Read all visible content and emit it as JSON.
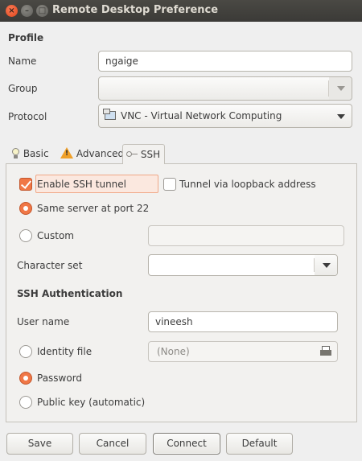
{
  "window": {
    "title": "Remote Desktop Preference",
    "close_glyph": "×",
    "min_glyph": "–",
    "max_glyph": "□"
  },
  "profile": {
    "section_title": "Profile",
    "name_label": "Name",
    "name_value": "ngaige",
    "group_label": "Group",
    "group_value": "",
    "protocol_label": "Protocol",
    "protocol_value": "VNC - Virtual Network Computing",
    "protocol_icon": "monitor-icon"
  },
  "tabs": [
    {
      "label": "Basic",
      "icon": "lightbulb-icon",
      "active": false
    },
    {
      "label": "Advanced",
      "icon": "warning-icon",
      "active": false
    },
    {
      "label": "SSH",
      "icon": "key-icon",
      "active": true
    }
  ],
  "ssh": {
    "enable_tunnel_label": "Enable SSH tunnel",
    "enable_tunnel_checked": true,
    "loopback_label": "Tunnel via loopback address",
    "loopback_checked": false,
    "same_server_label": "Same server at port 22",
    "same_server_selected": true,
    "custom_label": "Custom",
    "custom_selected": false,
    "custom_value": "",
    "charset_label": "Character set",
    "charset_value": "",
    "auth_title": "SSH Authentication",
    "username_label": "User name",
    "username_value": "vineesh",
    "identity_label": "Identity file",
    "identity_selected": false,
    "identity_value": "(None)",
    "password_label": "Password",
    "password_selected": true,
    "pubkey_label": "Public key (automatic)",
    "pubkey_selected": false
  },
  "buttons": {
    "save": "Save",
    "cancel": "Cancel",
    "connect": "Connect",
    "default": "Default"
  },
  "colors": {
    "accent": "#f07746",
    "titlebar": "#3c3b37"
  }
}
